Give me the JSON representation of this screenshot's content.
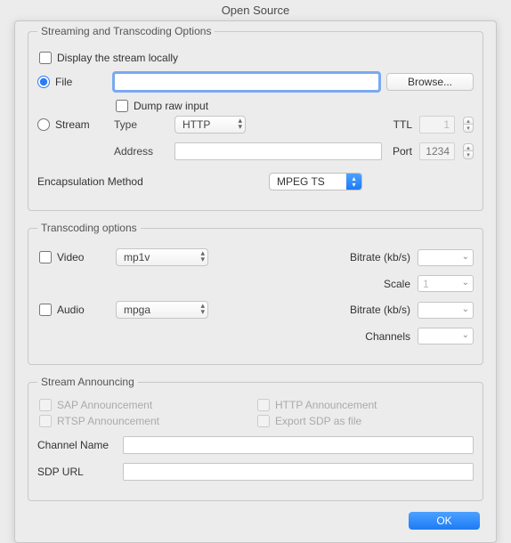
{
  "window_title": "Open Source",
  "sto": {
    "legend": "Streaming and Transcoding Options",
    "display_locally": "Display the stream locally",
    "file": "File",
    "file_value": "",
    "browse": "Browse...",
    "dump_raw": "Dump raw input",
    "stream": "Stream",
    "type_lbl": "Type",
    "type_value": "HTTP",
    "ttl_lbl": "TTL",
    "ttl_value": "1",
    "address_lbl": "Address",
    "address_value": "",
    "port_lbl": "Port",
    "port_placeholder": "1234",
    "encap_lbl": "Encapsulation Method",
    "encap_value": "MPEG TS"
  },
  "tco": {
    "legend": "Transcoding options",
    "video_lbl": "Video",
    "video_codec": "mp1v",
    "audio_lbl": "Audio",
    "audio_codec": "mpga",
    "bitrate_lbl": "Bitrate (kb/s)",
    "scale_lbl": "Scale",
    "scale_value": "1",
    "channels_lbl": "Channels"
  },
  "san": {
    "legend": "Stream Announcing",
    "sap": "SAP Announcement",
    "http": "HTTP Announcement",
    "rtsp": "RTSP Announcement",
    "sdp": "Export SDP as file",
    "chname_lbl": "Channel Name",
    "chname_value": "",
    "sdpurl_lbl": "SDP URL",
    "sdpurl_value": ""
  },
  "ok": "OK"
}
